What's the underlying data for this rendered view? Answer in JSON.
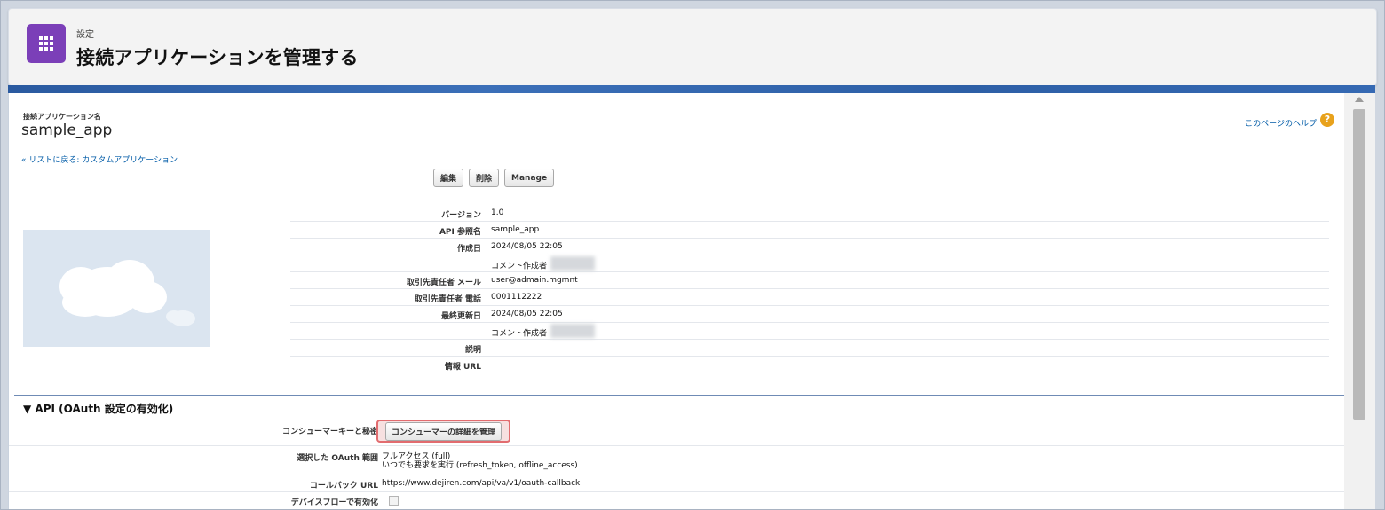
{
  "header": {
    "eyebrow": "設定",
    "title": "接続アプリケーションを管理する",
    "icon": "app-grid-icon",
    "icon_color": "#7b3fb8"
  },
  "page": {
    "name_label": "接続アプリケーション名",
    "app_name": "sample_app",
    "help_link": "このページのヘルプ",
    "back_link": "« リストに戻る: カスタムアプリケーション"
  },
  "buttons": {
    "edit": "編集",
    "delete": "削除",
    "manage": "Manage"
  },
  "details": [
    {
      "label": "バージョン",
      "value": "1.0"
    },
    {
      "label": "API 参照名",
      "value": "sample_app"
    },
    {
      "label": "作成日",
      "value": "2024/08/05 22:05"
    },
    {
      "label": "",
      "value": "コメント作成者"
    },
    {
      "label": "取引先責任者 メール",
      "value": "user@admain.mgmnt"
    },
    {
      "label": "取引先責任者 電話",
      "value": "0001112222"
    },
    {
      "label": "最終更新日",
      "value": "2024/08/05 22:05"
    },
    {
      "label": "",
      "value": "コメント作成者"
    },
    {
      "label": "説明",
      "value": ""
    },
    {
      "label": "情報 URL",
      "value": ""
    }
  ],
  "api_section": {
    "title": "▼ API (OAuth 設定の有効化)",
    "consumer_label": "コンシューマーキーと秘密",
    "consumer_button": "コンシューマーの詳細を管理",
    "scopes_label": "選択した OAuth 範囲",
    "scope_1": "フルアクセス (full)",
    "scope_2": "いつでも要求を実行 (refresh_token, offline_access)",
    "callback_label": "コールバック URL",
    "callback_value": "https://www.dejiren.com/api/va/v1/oauth-callback",
    "device_flow_label": "デバイスフローで有効化"
  }
}
